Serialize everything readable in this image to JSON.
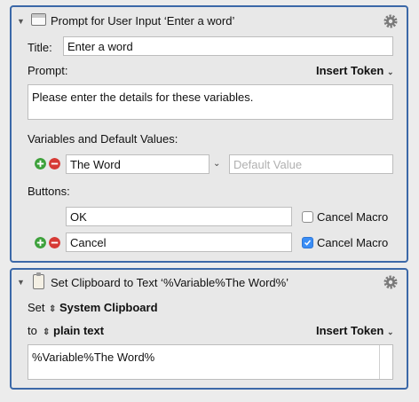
{
  "prompt_action": {
    "title": "Prompt for User Input ‘Enter a word’",
    "title_label": "Title:",
    "title_value": "Enter a word",
    "prompt_label": "Prompt:",
    "insert_token": "Insert Token",
    "prompt_text": "Please enter the details for these variables.",
    "variables_label": "Variables and Default Values:",
    "variable_name": "The Word",
    "default_placeholder": "Default Value",
    "buttons_label": "Buttons:",
    "buttons": [
      {
        "label": "OK",
        "cancel_macro_label": "Cancel Macro",
        "cancel_checked": false
      },
      {
        "label": "Cancel",
        "cancel_macro_label": "Cancel Macro",
        "cancel_checked": true
      }
    ],
    "icons": {
      "collapse": "disclosure-triangle-icon",
      "action": "window-icon",
      "settings": "gear-icon",
      "add": "plus-icon",
      "remove": "minus-icon",
      "dropdown": "chevron-down-icon"
    }
  },
  "clipboard_action": {
    "title": "Set Clipboard to Text ‘%Variable%The Word%’",
    "set_label": "Set",
    "clipboard_value": "System Clipboard",
    "to_label": "to",
    "format_value": "plain text",
    "insert_token": "Insert Token",
    "text_value": "%Variable%The Word%",
    "icons": {
      "collapse": "disclosure-triangle-icon",
      "action": "clipboard-icon",
      "settings": "gear-icon"
    }
  },
  "colors": {
    "border": "#3b68a8",
    "add": "#3da13b",
    "remove": "#d63a35",
    "check": "#3a8df5"
  }
}
